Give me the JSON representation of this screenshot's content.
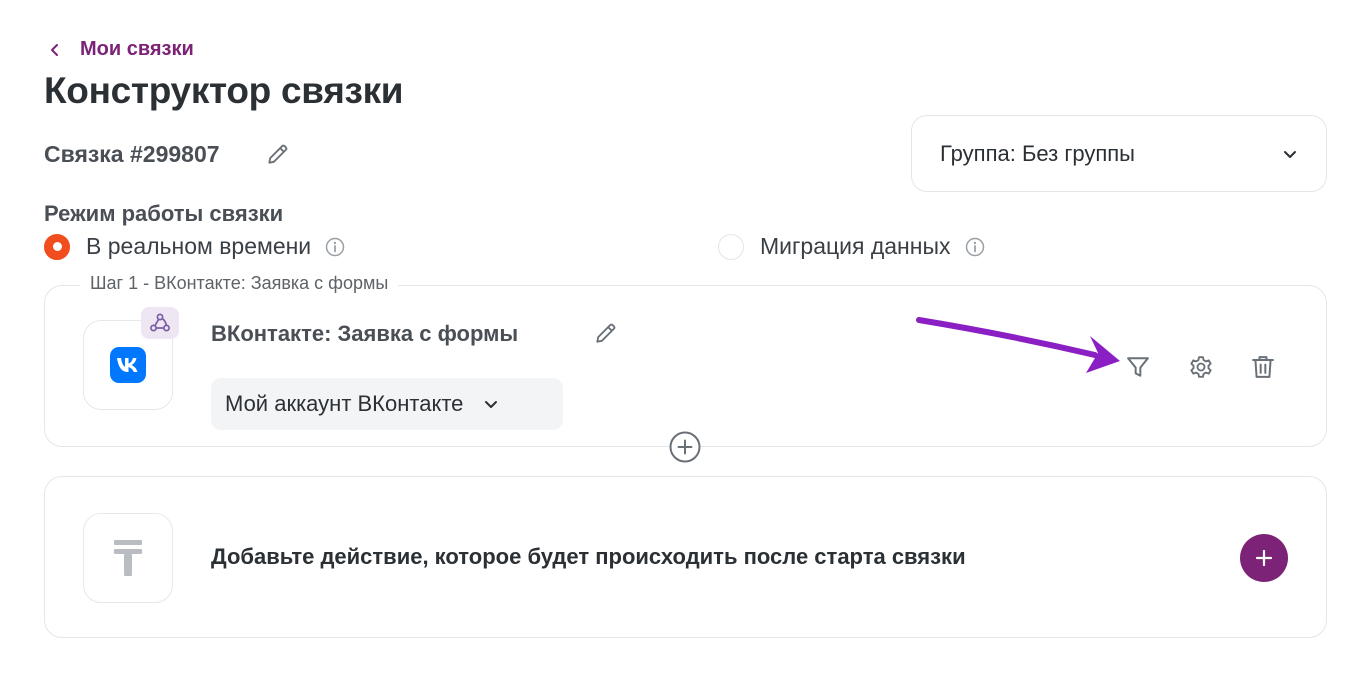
{
  "nav": {
    "back_label": "Мои связки"
  },
  "page": {
    "title": "Конструктор связки"
  },
  "bundle": {
    "name": "Связка #299807"
  },
  "group_select": {
    "value": "Группа: Без группы"
  },
  "mode": {
    "label": "Режим работы связки",
    "options": [
      {
        "label": "В реальном времени",
        "selected": true
      },
      {
        "label": "Миграция данных",
        "selected": false
      }
    ]
  },
  "step": {
    "legend": "Шаг 1 - ВКонтакте: Заявка с формы",
    "title": "ВКонтакте: Заявка с формы",
    "account": "Мой аккаунт ВКонтакте",
    "app_icon": "vk-logo",
    "badge_icon": "webhook-icon",
    "tools": [
      "filter-icon",
      "gear-icon",
      "trash-icon"
    ]
  },
  "action": {
    "text": "Добавьте действие, которое будет происходить после старта связки"
  },
  "colors": {
    "accent": "#7c2378",
    "radio_active": "#f24d1e",
    "vk_blue": "#0077ff",
    "annotation_arrow": "#8a1fc4"
  }
}
